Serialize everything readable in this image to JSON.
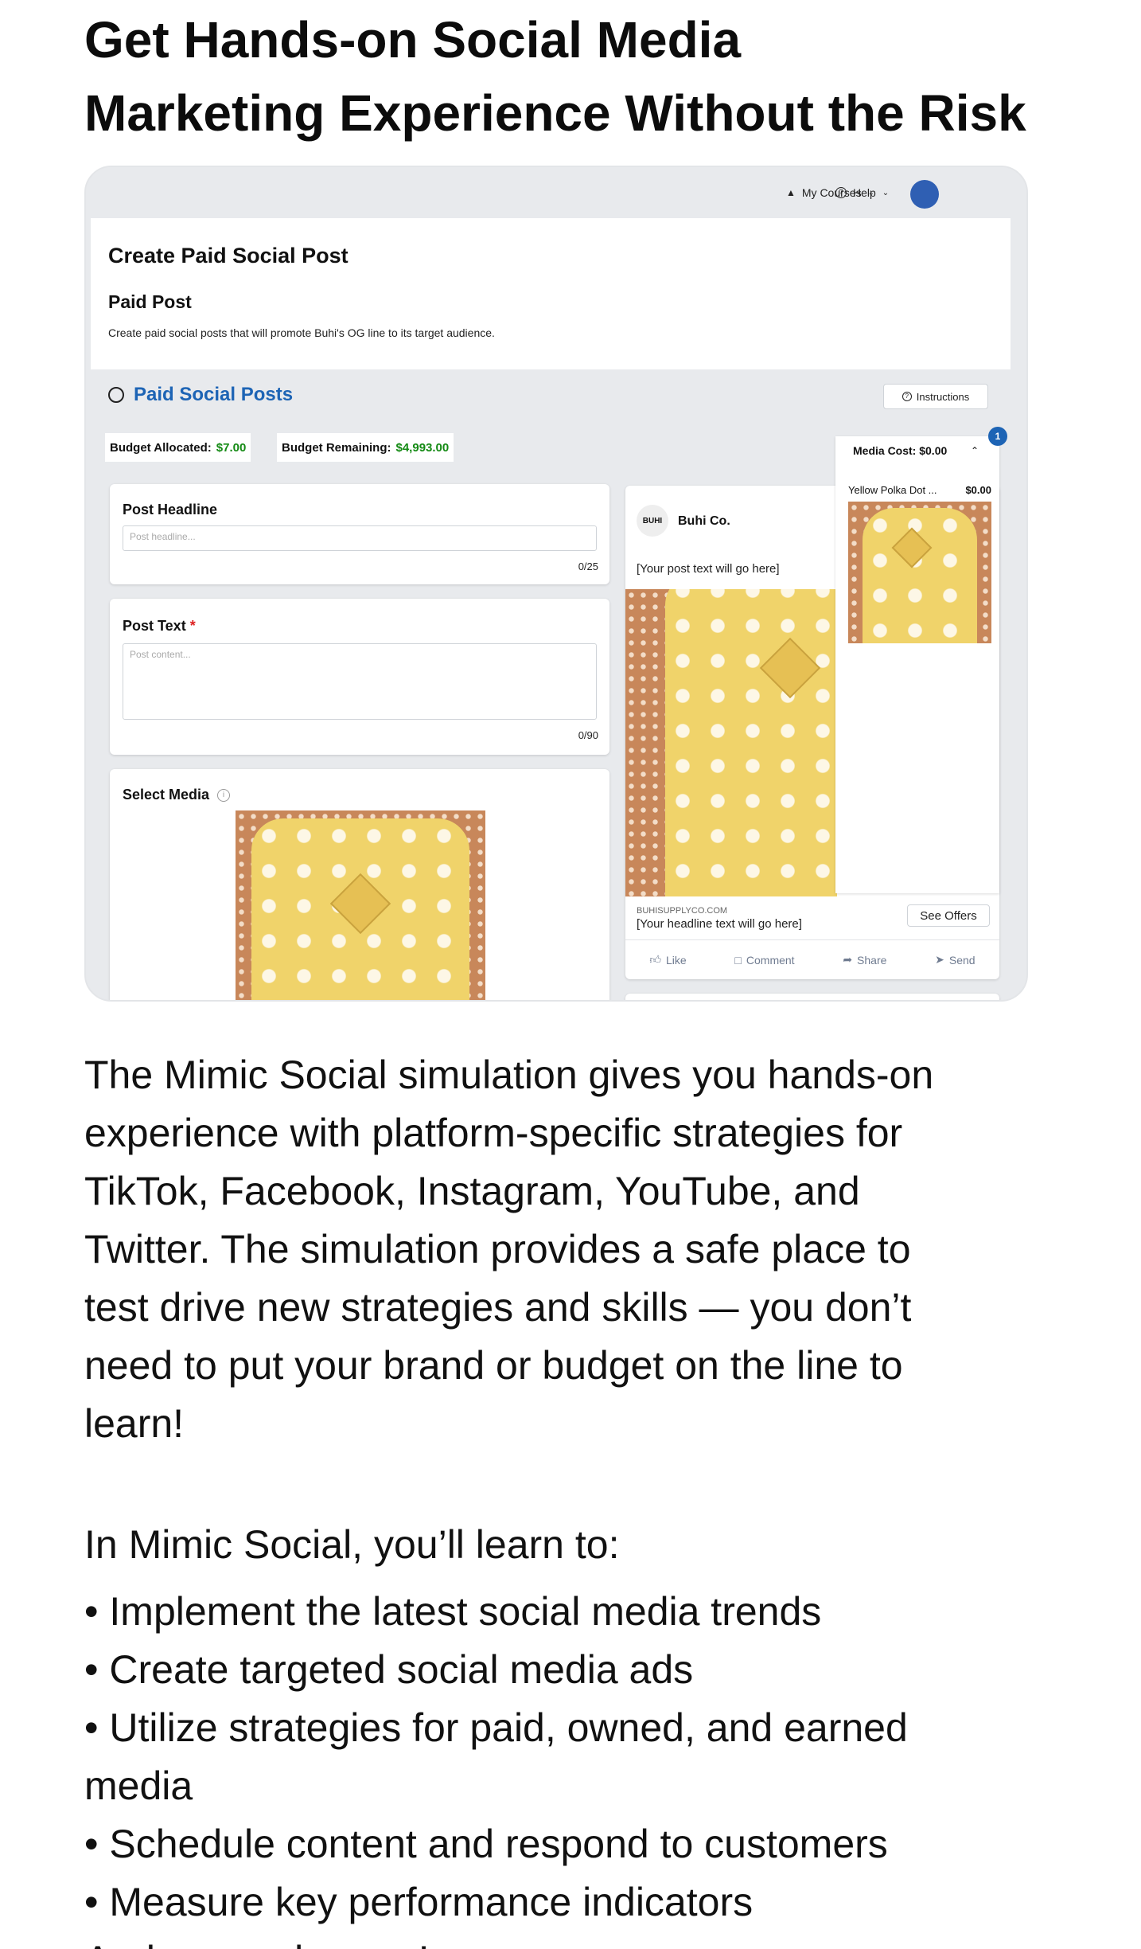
{
  "headline": {
    "line1": "Get Hands-on Social Media",
    "line2": "Marketing Experience Without the Risk"
  },
  "screenshot": {
    "topbar": {
      "my_courses": "My Courses",
      "help": "Help",
      "avatar_color": "#2f5fb3"
    },
    "page": {
      "title": "Create Paid Social Post",
      "subtitle": "Paid Post",
      "description": "Create paid social posts that will promote Buhi's OG line to its target audience."
    },
    "section_title": "Paid Social Posts",
    "instructions_label": "Instructions",
    "budget_allocated_label": "Budget Allocated:",
    "budget_allocated_value": "$7.00",
    "budget_remaining_label": "Budget Remaining:",
    "budget_remaining_value": "$4,993.00",
    "post_headline": {
      "label": "Post Headline",
      "placeholder": "Post headline...",
      "counter": "0/25"
    },
    "post_text": {
      "label": "Post Text",
      "required_mark": "*",
      "placeholder": "Post content...",
      "counter": "0/90"
    },
    "select_media_label": "Select Media",
    "preview": {
      "logo": "BUHI",
      "brand": "Buhi Co.",
      "post_text": "[Your post text will go here]",
      "url": "BUHISUPPLYCO.COM",
      "headline": "[Your headline text will go here]",
      "see_offers": "See Offers",
      "actions": [
        "Like",
        "Comment",
        "Share",
        "Send"
      ]
    },
    "media_cost": {
      "label": "Media Cost: $0.00",
      "badge": "1",
      "item_name": "Yellow Polka Dot ...",
      "item_price": "$0.00"
    },
    "accent_color": "#1d64b5",
    "budget_color": "#148a14"
  },
  "body": {
    "paragraph": [
      "The Mimic Social simulation gives you hands-on",
      "experience with platform-specific strategies for",
      "TikTok, Facebook, Instagram, YouTube, and",
      "Twitter. The simulation provides a safe place to",
      "test drive new strategies and skills — you don’t",
      "need to put your brand or budget on the line to",
      "learn!"
    ],
    "intro": "In Mimic Social, you’ll learn to:",
    "bullets": [
      "• Implement the latest social media trends",
      "• Create targeted social media ads",
      "• Utilize strategies for paid, owned, and earned",
      "media",
      "• Schedule content and respond to customers",
      "• Measure key performance indicators"
    ],
    "closing": "And so much more!"
  }
}
